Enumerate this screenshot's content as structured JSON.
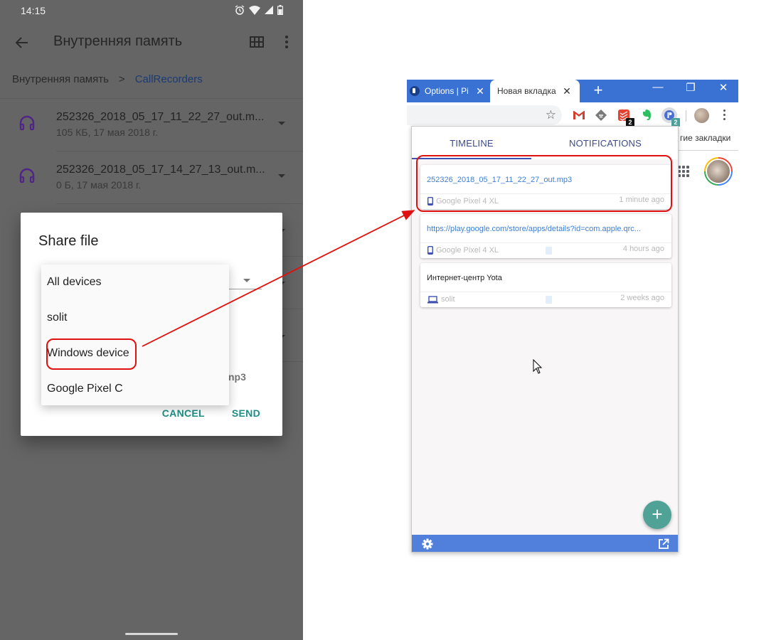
{
  "phone": {
    "status_bar": {
      "time": "14:15",
      "icons": [
        "alarm-icon",
        "wifi-icon",
        "signal-icon",
        "battery-icon"
      ]
    },
    "app_bar": {
      "title": "Внутренняя память",
      "icons": [
        "back-arrow-icon",
        "grid-view-icon",
        "more-vert-icon"
      ]
    },
    "breadcrumb": {
      "items": [
        "Внутренняя память",
        "CallRecorders"
      ],
      "separator": ">"
    },
    "files": [
      {
        "name": "252326_2018_05_17_11_22_27_out.m...",
        "meta": "105 КБ, 17 мая 2018 г.",
        "icon": "headphones-icon"
      },
      {
        "name": "252326_2018_05_17_14_27_13_out.m...",
        "meta": "0 Б, 17 мая 2018 г.",
        "icon": "headphones-icon"
      }
    ],
    "dialog": {
      "title": "Share file",
      "filename_fragment": "np3",
      "cancel_label": "CANCEL",
      "send_label": "SEND",
      "dropdown_options": [
        "All devices",
        "solit",
        "Windows device",
        "Google Pixel C"
      ],
      "highlighted_option": "Windows device"
    }
  },
  "browser": {
    "tabs": [
      {
        "label": "Options | Pi",
        "active": false
      },
      {
        "label": "Новая вкладка",
        "active": true
      }
    ],
    "new_tab_label": "+",
    "window_controls": {
      "minimize": "—",
      "restore": "❐",
      "close": "✕"
    },
    "extensions": [
      {
        "name": "gmail",
        "badge": ""
      },
      {
        "name": "feedly",
        "badge": ""
      },
      {
        "name": "todoist",
        "badge": "2"
      },
      {
        "name": "evernote",
        "badge": ""
      },
      {
        "name": "pushbullet",
        "badge": "2"
      }
    ],
    "bookmarks_fragment": "гие закладки",
    "colors": {
      "tabstrip": "#3a72d3",
      "popup_footer": "#517fdc",
      "fab": "#50a297",
      "link": "#3d7fd6",
      "annotation": "#e01010"
    }
  },
  "popup": {
    "tabs": [
      "TIMELINE",
      "NOTIFICATIONS"
    ],
    "active_tab": "TIMELINE",
    "items": [
      {
        "title": "252326_2018_05_17_11_22_27_out.mp3",
        "type": "link",
        "device": "Google Pixel 4 XL",
        "device_type": "phone",
        "time": "1 minute ago",
        "highlighted": true
      },
      {
        "title": "https://play.google.com/store/apps/details?id=com.apple.qrc...",
        "type": "link",
        "device": "Google Pixel 4 XL",
        "device_type": "phone",
        "time": "4 hours ago",
        "highlighted": false
      },
      {
        "title": "Интернет-центр Yota",
        "type": "text",
        "device": "solit",
        "device_type": "laptop",
        "time": "2 weeks ago",
        "highlighted": false
      }
    ],
    "fab_label": "+",
    "footer_icons": [
      "settings-icon",
      "open-in-new-icon"
    ]
  }
}
